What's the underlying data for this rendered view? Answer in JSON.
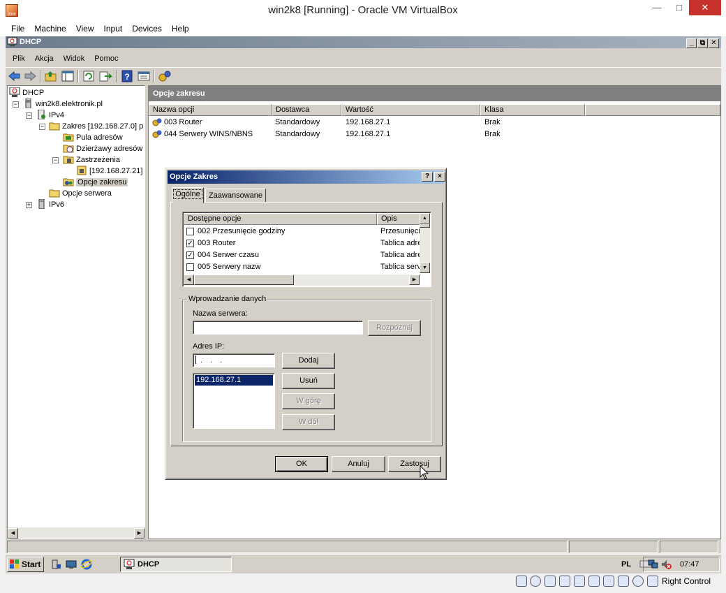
{
  "host": {
    "title": "win2k8 [Running] - Oracle VM VirtualBox",
    "app_icon_text": "2008",
    "menu": [
      "File",
      "Machine",
      "View",
      "Input",
      "Devices",
      "Help"
    ],
    "right_ctrl": "Right Control"
  },
  "mmc": {
    "window_title": "DHCP",
    "menu": [
      "Plik",
      "Akcja",
      "Widok",
      "Pomoc"
    ],
    "toolbar_icons": [
      "back-icon",
      "forward-icon",
      "up-folder-icon",
      "show-tree-icon",
      "refresh-icon",
      "export-icon",
      "help-icon",
      "properties-icon",
      "dhcp-options-icon"
    ]
  },
  "tree": {
    "nodes": [
      {
        "label": "DHCP",
        "icon": "dhcp-icon"
      },
      {
        "label": "win2k8.elektronik.pl",
        "icon": "server-icon"
      },
      {
        "label": "IPv4",
        "icon": "ipv4-icon"
      },
      {
        "label": "Zakres [192.168.27.0] p",
        "icon": "folder-icon"
      },
      {
        "label": "Pula adresów",
        "icon": "address-pool-icon"
      },
      {
        "label": "Dzierżawy adresów",
        "icon": "leases-icon"
      },
      {
        "label": "Zastrzeżenia",
        "icon": "reservations-icon"
      },
      {
        "label": "[192.168.27.21]",
        "icon": "reservation-icon"
      },
      {
        "label": "Opcje zakresu",
        "icon": "scope-options-icon"
      },
      {
        "label": "Opcje serwera",
        "icon": "folder-icon"
      },
      {
        "label": "IPv6",
        "icon": "server-icon"
      }
    ]
  },
  "rpane": {
    "header": "Opcje zakresu",
    "columns": [
      "Nazwa opcji",
      "Dostawca",
      "Wartość",
      "Klasa"
    ],
    "rows": [
      {
        "name": "003 Router",
        "vendor": "Standardowy",
        "value": "192.168.27.1",
        "class": "Brak"
      },
      {
        "name": "044 Serwery WINS/NBNS",
        "vendor": "Standardowy",
        "value": "192.168.27.1",
        "class": "Brak"
      }
    ]
  },
  "dialog": {
    "title": "Opcje Zakres",
    "help_btn": "?",
    "close_btn": "×",
    "tabs": [
      "Ogólne",
      "Zaawansowane"
    ],
    "list_columns": [
      "Dostępne opcje",
      "Opis"
    ],
    "options": [
      {
        "label": "002 Przesunięcie godziny",
        "desc": "Przesunięci",
        "checked": false
      },
      {
        "label": "003 Router",
        "desc": "Tablica adre",
        "checked": true
      },
      {
        "label": "004 Serwer czasu",
        "desc": "Tablica adre",
        "checked": true
      },
      {
        "label": "005 Serwery nazw",
        "desc": "Tablica serv",
        "checked": false
      }
    ],
    "group_title": "Wprowadzanie danych",
    "server_name_label": "Nazwa serwera:",
    "server_name_value": "",
    "resolve_btn": "Rozpoznaj",
    "ip_label": "Adres IP:",
    "ip_placeholder": ".   .   .",
    "ip_list": [
      "192.168.27.1"
    ],
    "add_btn": "Dodaj",
    "remove_btn": "Usuń",
    "up_btn": "W górę",
    "down_btn": "W dół",
    "ok_btn": "OK",
    "cancel_btn": "Anuluj",
    "apply_btn": "Zastosuj"
  },
  "taskbar": {
    "start": "Start",
    "task": "DHCP",
    "lang": "PL",
    "time": "07:47"
  }
}
